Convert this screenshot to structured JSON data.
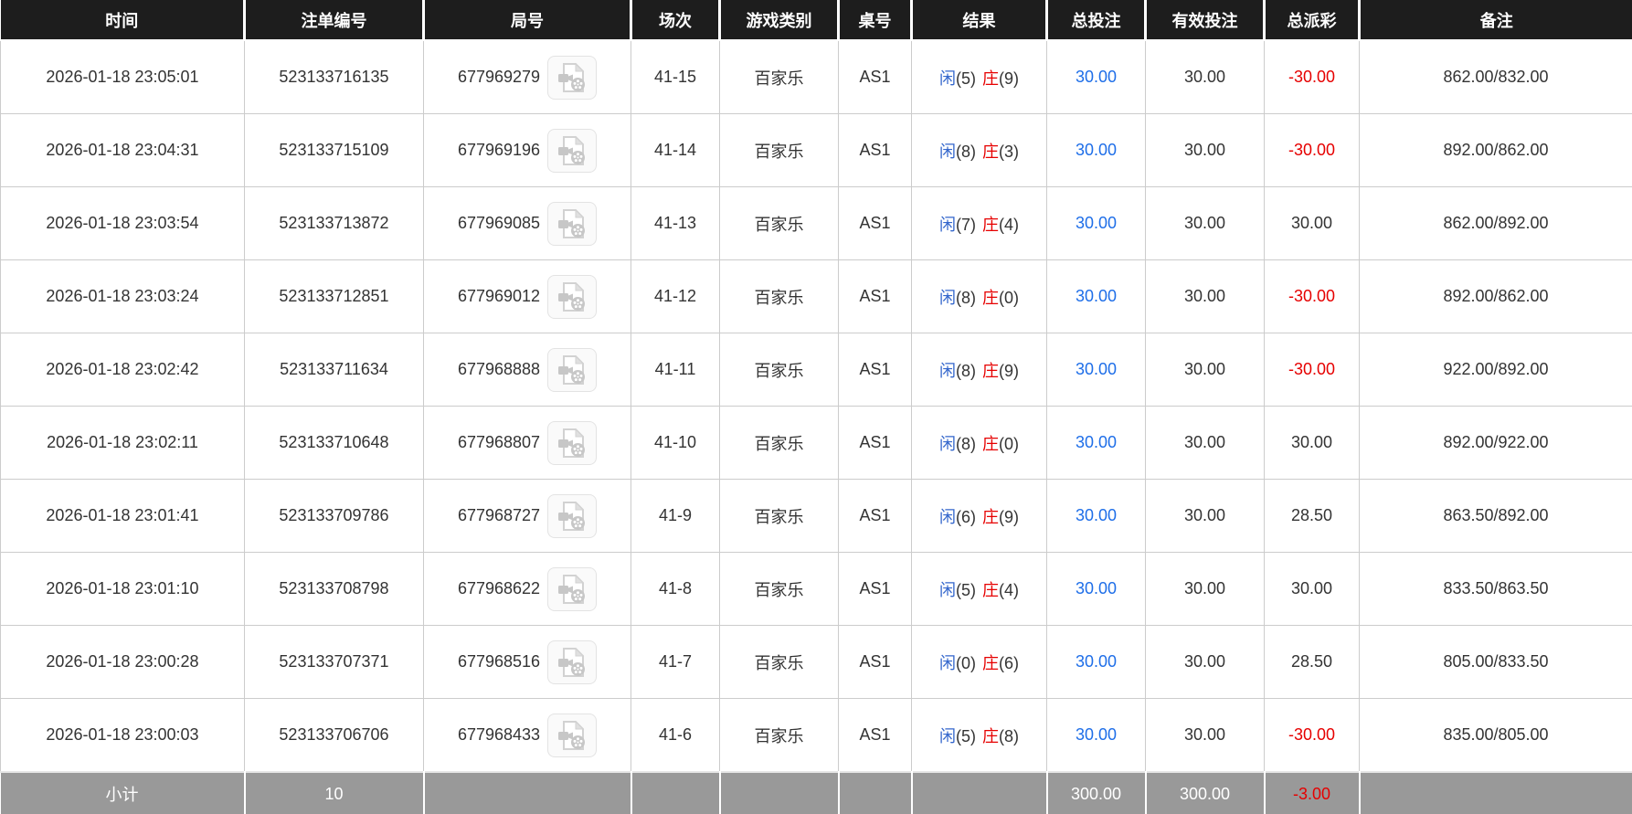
{
  "colors": {
    "header_bg": "#1d1d1d",
    "header_text": "#ffffff",
    "body_text": "#333333",
    "player_blue": "#3366cc",
    "banker_red": "#e60000",
    "total_bet_blue": "#1e6ee8",
    "negative_red": "#e60000",
    "footer_bg": "#999999",
    "footer_text": "#ffffff",
    "border_gray": "#cccccc"
  },
  "icons": {
    "video_replay": "video-file-icon"
  },
  "table": {
    "columns": [
      "时间",
      "注单编号",
      "局号",
      "场次",
      "游戏类别",
      "桌号",
      "结果",
      "总投注",
      "有效投注",
      "总派彩",
      "备注"
    ],
    "rows": [
      {
        "time": "2026-01-18 23:05:01",
        "bet_no": "523133716135",
        "game_no": "677969279",
        "session": "41-15",
        "game_type": "百家乐",
        "table_no": "AS1",
        "player": "闲",
        "player_pts": "(5)",
        "banker": "庄",
        "banker_pts": "(9)",
        "total_bet": "30.00",
        "valid_bet": "30.00",
        "payout": "-30.00",
        "remark": "862.00/832.00"
      },
      {
        "time": "2026-01-18 23:04:31",
        "bet_no": "523133715109",
        "game_no": "677969196",
        "session": "41-14",
        "game_type": "百家乐",
        "table_no": "AS1",
        "player": "闲",
        "player_pts": "(8)",
        "banker": "庄",
        "banker_pts": "(3)",
        "total_bet": "30.00",
        "valid_bet": "30.00",
        "payout": "-30.00",
        "remark": "892.00/862.00"
      },
      {
        "time": "2026-01-18 23:03:54",
        "bet_no": "523133713872",
        "game_no": "677969085",
        "session": "41-13",
        "game_type": "百家乐",
        "table_no": "AS1",
        "player": "闲",
        "player_pts": "(7)",
        "banker": "庄",
        "banker_pts": "(4)",
        "total_bet": "30.00",
        "valid_bet": "30.00",
        "payout": "30.00",
        "remark": "862.00/892.00"
      },
      {
        "time": "2026-01-18 23:03:24",
        "bet_no": "523133712851",
        "game_no": "677969012",
        "session": "41-12",
        "game_type": "百家乐",
        "table_no": "AS1",
        "player": "闲",
        "player_pts": "(8)",
        "banker": "庄",
        "banker_pts": "(0)",
        "total_bet": "30.00",
        "valid_bet": "30.00",
        "payout": "-30.00",
        "remark": "892.00/862.00"
      },
      {
        "time": "2026-01-18 23:02:42",
        "bet_no": "523133711634",
        "game_no": "677968888",
        "session": "41-11",
        "game_type": "百家乐",
        "table_no": "AS1",
        "player": "闲",
        "player_pts": "(8)",
        "banker": "庄",
        "banker_pts": "(9)",
        "total_bet": "30.00",
        "valid_bet": "30.00",
        "payout": "-30.00",
        "remark": "922.00/892.00"
      },
      {
        "time": "2026-01-18 23:02:11",
        "bet_no": "523133710648",
        "game_no": "677968807",
        "session": "41-10",
        "game_type": "百家乐",
        "table_no": "AS1",
        "player": "闲",
        "player_pts": "(8)",
        "banker": "庄",
        "banker_pts": "(0)",
        "total_bet": "30.00",
        "valid_bet": "30.00",
        "payout": "30.00",
        "remark": "892.00/922.00"
      },
      {
        "time": "2026-01-18 23:01:41",
        "bet_no": "523133709786",
        "game_no": "677968727",
        "session": "41-9",
        "game_type": "百家乐",
        "table_no": "AS1",
        "player": "闲",
        "player_pts": "(6)",
        "banker": "庄",
        "banker_pts": "(9)",
        "total_bet": "30.00",
        "valid_bet": "30.00",
        "payout": "28.50",
        "remark": "863.50/892.00"
      },
      {
        "time": "2026-01-18 23:01:10",
        "bet_no": "523133708798",
        "game_no": "677968622",
        "session": "41-8",
        "game_type": "百家乐",
        "table_no": "AS1",
        "player": "闲",
        "player_pts": "(5)",
        "banker": "庄",
        "banker_pts": "(4)",
        "total_bet": "30.00",
        "valid_bet": "30.00",
        "payout": "30.00",
        "remark": "833.50/863.50"
      },
      {
        "time": "2026-01-18 23:00:28",
        "bet_no": "523133707371",
        "game_no": "677968516",
        "session": "41-7",
        "game_type": "百家乐",
        "table_no": "AS1",
        "player": "闲",
        "player_pts": "(0)",
        "banker": "庄",
        "banker_pts": "(6)",
        "total_bet": "30.00",
        "valid_bet": "30.00",
        "payout": "28.50",
        "remark": "805.00/833.50"
      },
      {
        "time": "2026-01-18 23:00:03",
        "bet_no": "523133706706",
        "game_no": "677968433",
        "session": "41-6",
        "game_type": "百家乐",
        "table_no": "AS1",
        "player": "闲",
        "player_pts": "(5)",
        "banker": "庄",
        "banker_pts": "(8)",
        "total_bet": "30.00",
        "valid_bet": "30.00",
        "payout": "-30.00",
        "remark": "835.00/805.00"
      }
    ],
    "footer": {
      "label": "小计",
      "count": "10",
      "total_bet": "300.00",
      "valid_bet": "300.00",
      "payout": "-3.00"
    }
  }
}
